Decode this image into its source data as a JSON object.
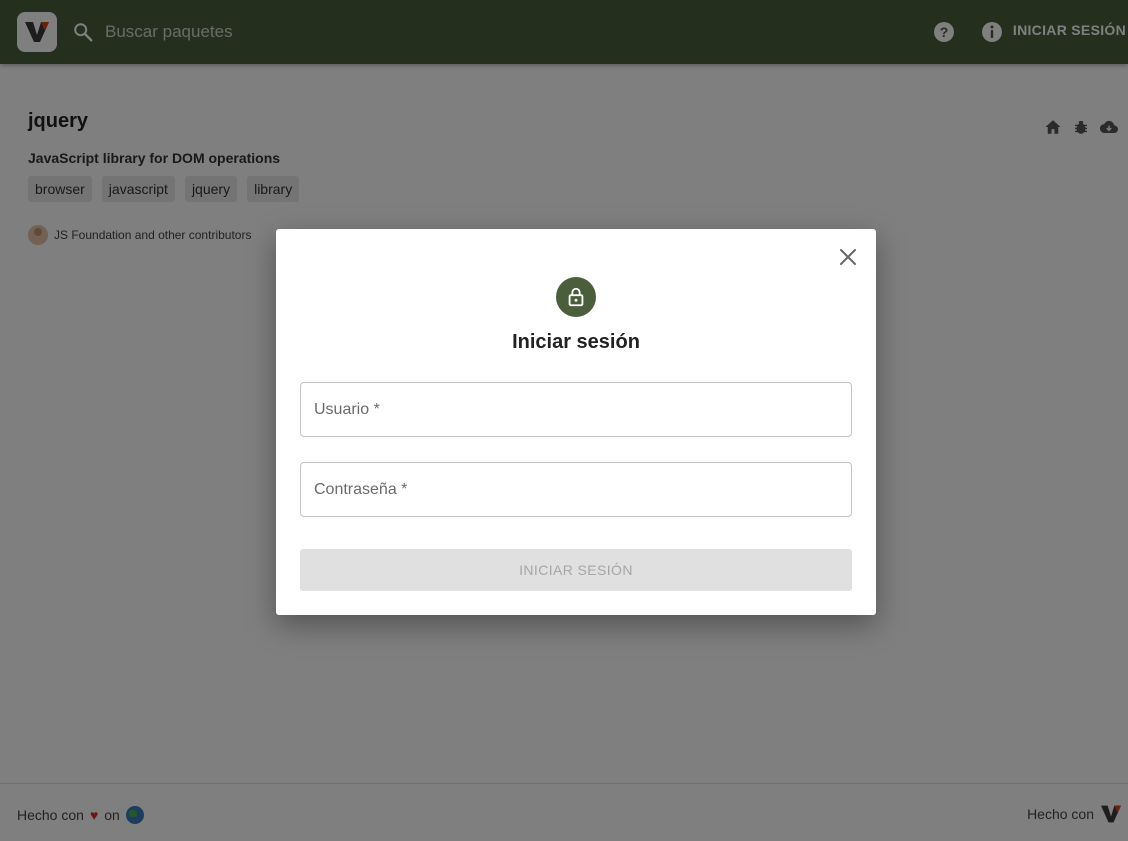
{
  "header": {
    "search_placeholder": "Buscar paquetes",
    "help_icon": "help-icon",
    "info_icon": "info-icon",
    "login_label": "INICIAR SESIÓN",
    "bg_color": "#4a5e3c"
  },
  "package": {
    "name": "jquery",
    "description": "JavaScript library for DOM operations",
    "tags": [
      "browser",
      "javascript",
      "jquery",
      "library"
    ],
    "author": "JS Foundation and other contributors",
    "actions": [
      "home-icon",
      "bug-icon",
      "cloud-download-icon"
    ]
  },
  "dialog": {
    "title": "Iniciar sesión",
    "username_placeholder": "Usuario *",
    "password_placeholder": "Contraseña *",
    "submit_label": "INICIAR SESIÓN",
    "accent_color": "#4a5e3c"
  },
  "footer": {
    "left_prefix": "Hecho con",
    "heart": "♥",
    "left_suffix": "on",
    "right_prefix": "Hecho con"
  }
}
